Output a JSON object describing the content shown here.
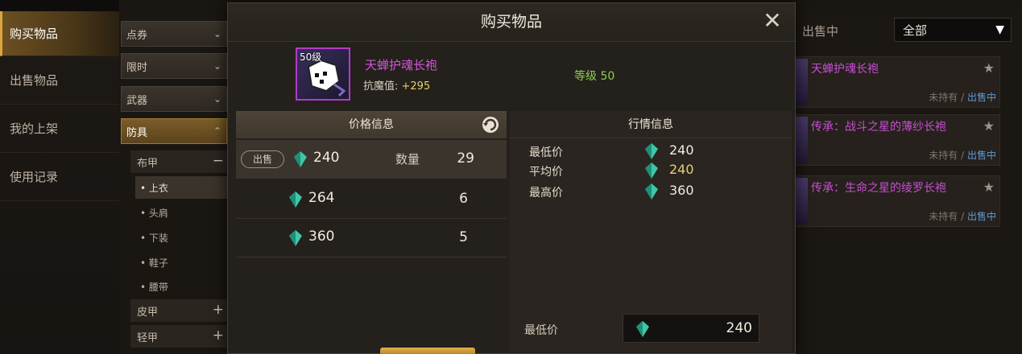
{
  "leftnav": {
    "items": [
      {
        "label": "购买物品",
        "active": true
      },
      {
        "label": "出售物品",
        "active": false
      },
      {
        "label": "我的上架",
        "active": false
      },
      {
        "label": "使用记录",
        "active": false
      }
    ]
  },
  "filters": {
    "categories": [
      "点券",
      "限时",
      "武器",
      "防具"
    ],
    "armor_subs": [
      "布甲",
      "皮甲",
      "轻甲"
    ],
    "cloth_items": [
      "• 上衣",
      "• 头肩",
      "• 下装",
      "• 鞋子",
      "• 腰带"
    ]
  },
  "rightlist": {
    "status_label": "出售中",
    "filter_value": "全部",
    "items": [
      {
        "name": "天蝉护魂长袍",
        "own": "未持有",
        "sep": " / ",
        "state": "出售中"
      },
      {
        "name": "传承：战斗之星的薄纱长袍",
        "own": "未持有",
        "sep": " / ",
        "state": "出售中"
      },
      {
        "name": "传承：生命之星的绫罗长袍",
        "own": "未持有",
        "sep": " / ",
        "state": "出售中"
      }
    ]
  },
  "modal": {
    "title": "购买物品",
    "close_icon": "close-icon",
    "item": {
      "level_badge": "50级",
      "name": "天蝉护魂长袍",
      "stat_label": "抗魔值: ",
      "stat_value": "+295",
      "level_text": "等级 50"
    },
    "price_panel": {
      "title": "价格信息",
      "sell_badge": "出售",
      "quantity_label": "数量",
      "rows": [
        {
          "price": "240",
          "qty": "29"
        },
        {
          "price": "264",
          "qty": "6"
        },
        {
          "price": "360",
          "qty": "5"
        }
      ]
    },
    "market_panel": {
      "title": "行情信息",
      "rows": [
        {
          "label": "最低价",
          "value": "240"
        },
        {
          "label": "平均价",
          "value": "240"
        },
        {
          "label": "最高价",
          "value": "360"
        }
      ],
      "min_label": "最低价",
      "min_value": "240"
    },
    "colors": {
      "accent_gold": "#d9a441",
      "epic_purple": "#d255dd",
      "level_green": "#8ed04f",
      "gem_teal": "#3fc7a8"
    }
  }
}
